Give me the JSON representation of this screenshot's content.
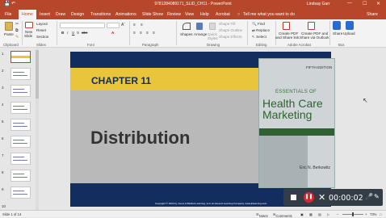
{
  "window": {
    "title": "9781284089171_SLID_CH11  -  PowerPoint",
    "user": "Lindsay Garr",
    "autosave_icon": "save-icon",
    "min": "—",
    "max": "☐",
    "close": "✕"
  },
  "tabs": [
    "File",
    "Home",
    "Insert",
    "Draw",
    "Design",
    "Transitions",
    "Animations",
    "Slide Show",
    "Review",
    "View",
    "Help",
    "Acrobat",
    "Tell me what you want to do",
    "Share"
  ],
  "active_tab": "Home",
  "ribbon": {
    "clipboard": {
      "paste": "Paste",
      "label": "Clipboard"
    },
    "slides": {
      "new": "New",
      "new2": "Slide",
      "layout": "Layout",
      "reset": "Reset",
      "section": "Section",
      "label": "Slides"
    },
    "font": {
      "label": "Font",
      "bold": "B",
      "italic": "I",
      "underline": "U",
      "shadow": "S",
      "strike": "abc",
      "fontcolor": "A"
    },
    "paragraph": {
      "label": "Paragraph"
    },
    "drawing": {
      "shapes": "Shapes",
      "arrange": "Arrange",
      "quick": "Quick",
      "styles": "Styles",
      "fill": "Shape Fill",
      "outline": "Shape Outline",
      "effects": "Shape Effects",
      "label": "Drawing"
    },
    "editing": {
      "find": "Find",
      "replace": "Replace",
      "select": "Select",
      "label": "Editing"
    },
    "acrobat": {
      "create1": "Create PDF",
      "create2": "and Share link",
      "createb1": "Create PDF and",
      "createb2": "Share via Outlook",
      "label": "Adobe Acrobat"
    },
    "box": {
      "share": "Share",
      "upload": "Upload",
      "label": "Box"
    }
  },
  "thumbnails": [
    "1",
    "2",
    "3",
    "4",
    "5",
    "6",
    "7",
    "8",
    "9",
    "10"
  ],
  "slide": {
    "chapter": "CHAPTER 11",
    "title": "Distribution",
    "copyright": "Copyright © 2020 by Jones & Bartlett Learning, LLC an Ascend Learning Company. www.jblearning.com",
    "book": {
      "edition": "FIFTH EDITION",
      "essentials": "ESSENTIALS OF",
      "title1": "Health Care",
      "title2": "Marketing",
      "author": "Eric N. Berkowitz"
    },
    "colors": {
      "navy": "#132d5e",
      "gold": "#e9c53b",
      "gray": "#b9b9b9"
    }
  },
  "recorder": {
    "time": "00:00:02",
    "stop_icon": "stop-icon",
    "pause_icon": "pause-icon",
    "close_icon": "close-icon",
    "mic_icon": "mic-icon",
    "pen_icon": "pen-icon"
  },
  "statusbar": {
    "slide": "Slide 1 of 14",
    "notes": "Notes",
    "comments": "Comments",
    "zoom": "73%"
  }
}
